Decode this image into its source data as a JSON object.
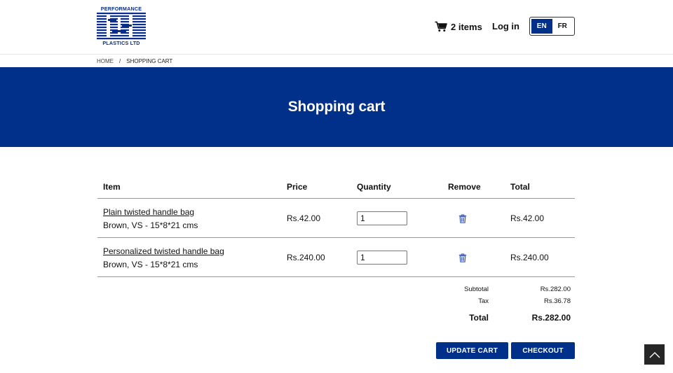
{
  "header": {
    "logo_top": "PERFORMANCE",
    "logo_bottom": "PLASTICS LTD",
    "cart_count": "2 items",
    "login": "Log in",
    "languages": [
      "EN",
      "FR"
    ],
    "active_language": "EN"
  },
  "breadcrumb": {
    "home": "HOME",
    "separator": "/",
    "current": "SHOPPING CART"
  },
  "hero": {
    "title": "Shopping cart"
  },
  "table": {
    "headers": {
      "item": "Item",
      "price": "Price",
      "quantity": "Quantity",
      "remove": "Remove",
      "total": "Total"
    },
    "rows": [
      {
        "name": "Plain twisted handle bag",
        "variant": "Brown, VS - 15*8*21 cms",
        "price": "Rs.42.00",
        "quantity": "1",
        "total": "Rs.42.00"
      },
      {
        "name": "Personalized twisted handle bag",
        "variant": "Brown, VS - 15*8*21 cms",
        "price": "Rs.240.00",
        "quantity": "1",
        "total": "Rs.240.00"
      }
    ]
  },
  "totals": {
    "subtotal_label": "Subtotal",
    "subtotal": "Rs.282.00",
    "tax_label": "Tax",
    "tax": "Rs.36.78",
    "total_label": "Total",
    "total": "Rs.282.00"
  },
  "actions": {
    "update": "UPDATE CART",
    "checkout": "CHECKOUT"
  },
  "icons": {
    "cart": "cart-icon",
    "remove": "trash-icon",
    "scroll_top": "chevron-up-icon"
  },
  "colors": {
    "brand": "#00308a",
    "scroll_top_bg": "#262626"
  }
}
